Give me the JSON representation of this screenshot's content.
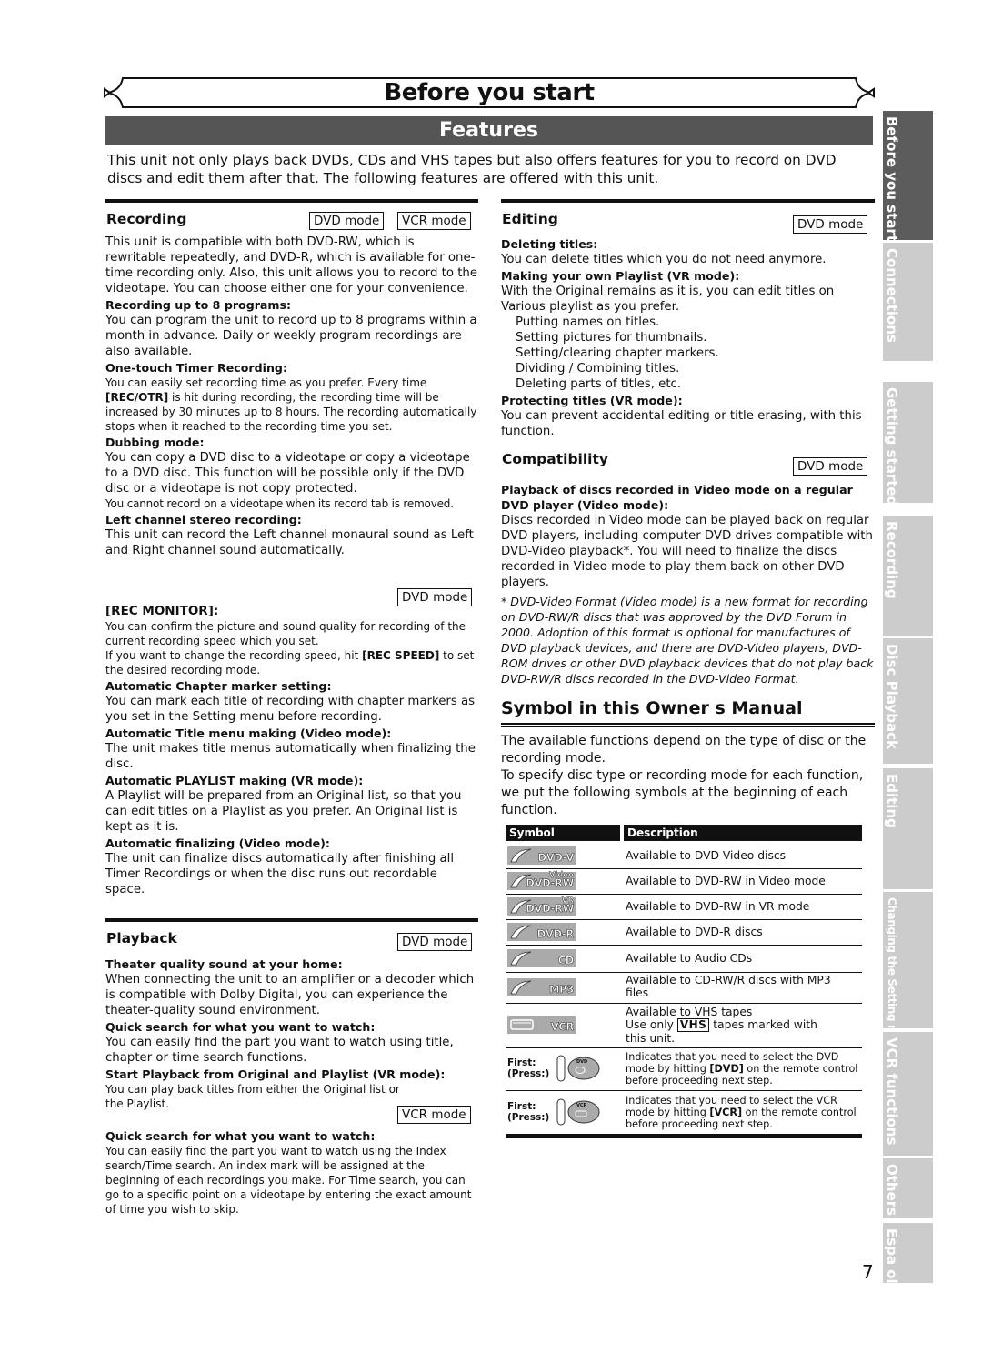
{
  "header": {
    "title": "Before you start",
    "section": "Features",
    "intro": "This unit not only plays back DVDs, CDs and VHS tapes but also offers features for you to record on DVD discs and edit them after that. The following features are offered with this unit."
  },
  "recording": {
    "heading": "Recording",
    "modes": [
      "DVD mode",
      "VCR mode"
    ],
    "intro": "This unit is compatible with both DVD-RW, which is rewritable repeatedly, and DVD-R, which is available for one-time recording only. Also, this unit allows you to record to the videotape.  You can choose either one for your convenience.",
    "items": [
      {
        "title": "Recording up to 8 programs:",
        "text": "You can program the unit to record up to 8 programs within a month in advance. Daily or weekly program recordings are also available."
      },
      {
        "title": "One-touch Timer Recording:",
        "text_pre": "You can easily set recording time as you prefer. Every time ",
        "key": "[REC/OTR]",
        "text_post": " is hit during recording, the recording time will be increased by 30 minutes up to 8 hours. The recording automatically stops when it reached to the recording time you set."
      },
      {
        "title": "Dubbing mode:",
        "text": "You can copy a DVD disc to a videotape or copy a videotape to a DVD disc. This function will be possible only if the DVD disc or a videotape is not copy protected.",
        "note": "You cannot record on a videotape when its record tab is removed."
      },
      {
        "title": "Left channel stereo recording:",
        "text": "This unit can record the Left channel monaural sound as Left and Right channel sound automatically."
      }
    ],
    "rec_monitor": {
      "mode": "DVD mode",
      "title": "[REC MONITOR]:",
      "text1": "You can confirm the picture and sound quality for recording of the current recording speed which you set.",
      "text2_pre": "If you want to change the recording speed, hit ",
      "key": "[REC SPEED]",
      "text2_post": " to set the desired recording mode."
    },
    "items2": [
      {
        "title": "Automatic Chapter marker setting:",
        "text": "You can mark each title of recording with chapter markers as you set in the Setting menu before recording."
      },
      {
        "title": "Automatic Title menu making (Video mode):",
        "text": "The unit makes title menus automatically when finalizing the disc."
      },
      {
        "title": "Automatic PLAYLIST making (VR mode):",
        "text": "A Playlist will be prepared from an Original list, so that you can edit titles on a Playlist as you prefer. An Original list is kept as it is."
      },
      {
        "title": "Automatic finalizing (Video mode):",
        "text": "The unit can finalize discs automatically after finishing all Timer Recordings or when the disc runs out recordable space."
      }
    ]
  },
  "playback": {
    "heading": "Playback",
    "mode": "DVD mode",
    "items": [
      {
        "title": "Theater quality sound at your home:",
        "text": "When connecting the unit to an amplifier or a decoder which is compatible with Dolby Digital, you can experience the theater-quality sound environment."
      },
      {
        "title": "Quick search for what you want to watch:",
        "text": "You can easily find the part you want to watch using title, chapter or time search functions."
      },
      {
        "title": "Start Playback from Original and Playlist (VR mode):",
        "text": "You can play back titles from either the Original list or the Playlist."
      }
    ],
    "vcr_mode": "VCR mode",
    "vcr_item": {
      "title": "Quick search for what you want to watch:",
      "text": "You can easily find the part you want to watch using the Index search/Time search. An index mark will be assigned at the beginning of each recordings you make. For Time search, you can go to a specific point on a videotape by entering the exact amount of time you wish to skip."
    }
  },
  "editing": {
    "heading": "Editing",
    "mode": "DVD mode",
    "del_title": "Deleting titles:",
    "del_text": "You can delete titles which you do not need anymore.",
    "pl_title": "Making your own Playlist (VR mode):",
    "pl_text": "With the Original remains as it is, you can edit titles on Various playlist as you prefer.",
    "pl_list": [
      "Putting names on titles.",
      "Setting pictures for thumbnails.",
      "Setting/clearing chapter markers.",
      "Dividing / Combining titles.",
      "Deleting parts of titles, etc."
    ],
    "prot_title": "Protecting titles (VR mode):",
    "prot_text": "You can prevent accidental editing or title erasing, with this function."
  },
  "compatibility": {
    "heading": "Compatibility",
    "mode": "DVD mode",
    "title": "Playback of discs recorded in Video mode on a regular DVD player (Video mode):",
    "text": "Discs recorded in Video mode can be played back on regular DVD players, including computer DVD drives compatible with DVD-Video playback*. You will need to finalize the discs recorded in Video mode to play them back on other DVD players.",
    "footnote": "* DVD-Video Format (Video mode) is a new format for recording on DVD-RW/R discs that was approved by the DVD Forum in 2000.  Adoption of this format is optional for manufactures of DVD playback devices, and there are DVD-Video players, DVD-ROM drives or other DVD playback devices that do not play back DVD-RW/R discs recorded in the DVD-Video Format."
  },
  "symbols": {
    "heading": "Symbol in this Owner s Manual",
    "intro1": "The available functions depend on the type of disc or the recording mode.",
    "intro2": "To specify disc type or recording mode for each function, we put the following symbols at the beginning of each function.",
    "col_symbol": "Symbol",
    "col_description": "Description",
    "rows": [
      {
        "icon": "DVD-V",
        "sup": "",
        "desc": "Available to DVD Video discs"
      },
      {
        "icon": "DVD-RW",
        "sup": "Video",
        "desc": "Available to DVD-RW in Video mode"
      },
      {
        "icon": "DVD-RW",
        "sup": "VR",
        "desc": "Available to DVD-RW in VR mode"
      },
      {
        "icon": "DVD-R",
        "sup": "",
        "desc": "Available to DVD-R discs"
      },
      {
        "icon": "CD",
        "sup": "",
        "desc": "Available to Audio CDs"
      },
      {
        "icon": "MP3",
        "sup": "",
        "desc": "Available to CD-RW/R discs with MP3 files"
      }
    ],
    "vcr_row": {
      "icon": "VCR",
      "line1": "Available to VHS tapes",
      "line2_pre": "Use only ",
      "vhs": "VHS",
      "line2_post": " tapes marked with",
      "line3": "this unit."
    },
    "press_rows": [
      {
        "first": "First:",
        "press": "(Press:)",
        "button": "DVD",
        "pre": "Indicates that you need to select the DVD mode by hitting ",
        "key": "[DVD]",
        "post": " on the remote control before proceeding next step."
      },
      {
        "first": "First:",
        "press": "(Press:)",
        "button": "VCR",
        "pre": "Indicates that you need to select the VCR mode by hitting ",
        "key": "[VCR]",
        "post": " on the remote control before proceeding next step."
      }
    ]
  },
  "side_tabs": [
    {
      "label": "Before you start",
      "active": true
    },
    {
      "label": "Connections",
      "active": false
    },
    {
      "label": "Getting started",
      "active": false
    },
    {
      "label": "Recording",
      "active": false
    },
    {
      "label": "Disc Playback",
      "active": false
    },
    {
      "label": "Editing",
      "active": false
    },
    {
      "label": "Changing the Setting menu",
      "active": false
    },
    {
      "label": "VCR functions",
      "active": false
    },
    {
      "label": "Others",
      "active": false
    },
    {
      "label": "Espa ol",
      "active": false
    }
  ],
  "page_number": "7",
  "colors": {
    "section_bar": "#555555",
    "tab_active": "#5c5c5c",
    "tab_inactive": "#cccccc",
    "icon_bg": "#aaaaaa"
  }
}
